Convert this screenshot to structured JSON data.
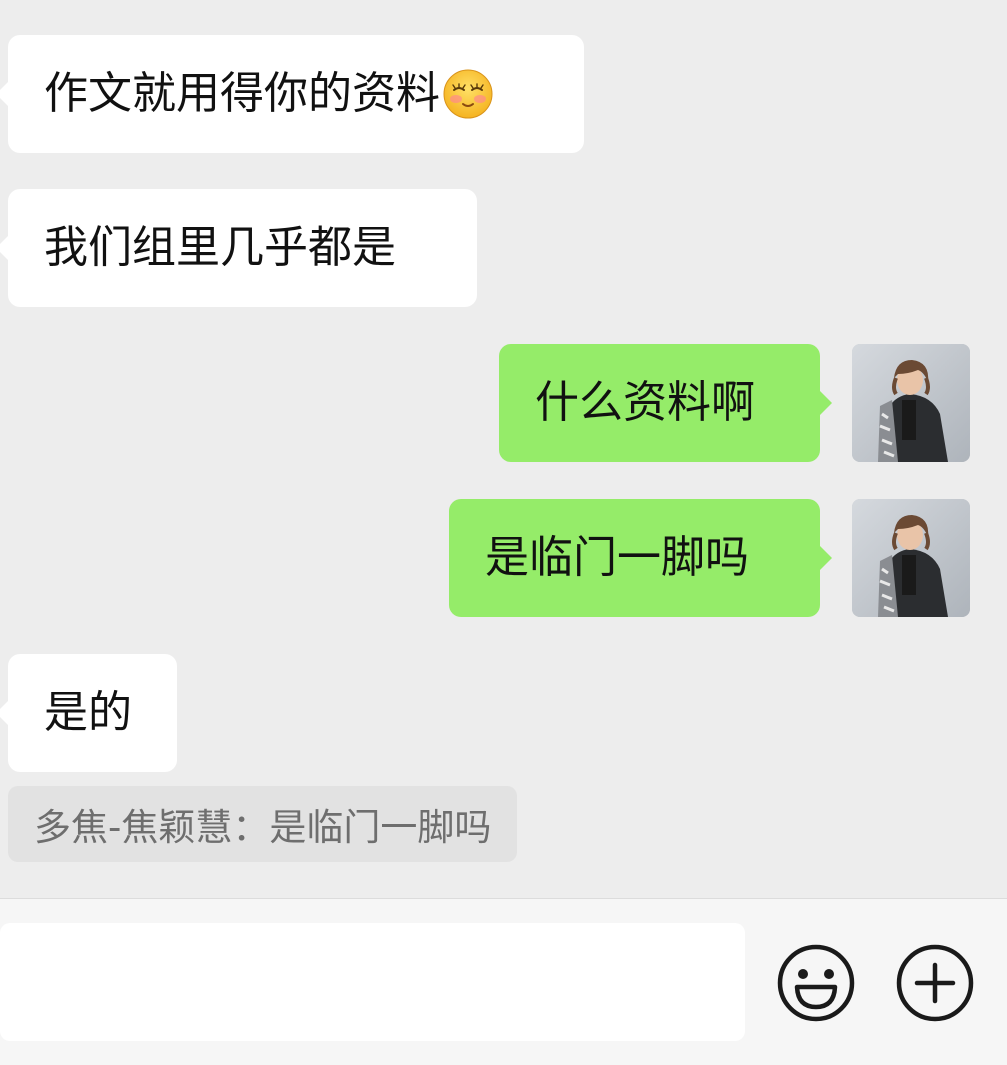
{
  "messages": [
    {
      "direction": "incoming",
      "text": "作文就用得你的资料",
      "emoji": "shy-smiling-face-icon"
    },
    {
      "direction": "incoming",
      "text": "我们组里几乎都是"
    },
    {
      "direction": "outgoing",
      "text": "什么资料啊"
    },
    {
      "direction": "outgoing",
      "text": "是临门一脚吗"
    },
    {
      "direction": "incoming",
      "text": "是的"
    }
  ],
  "quote": {
    "text": "多焦-焦颖慧：是临门一脚吗"
  },
  "input": {
    "value": "",
    "placeholder": ""
  },
  "toolbar": {
    "emoji_icon": "smiley-face-icon",
    "more_icon": "plus-circle-icon"
  },
  "colors": {
    "background": "#ededed",
    "incoming_bubble": "#ffffff",
    "outgoing_bubble": "#95ec69",
    "quote_background": "#e2e2e2",
    "quote_text": "#6e6e6e",
    "input_bar": "#f6f6f6"
  }
}
